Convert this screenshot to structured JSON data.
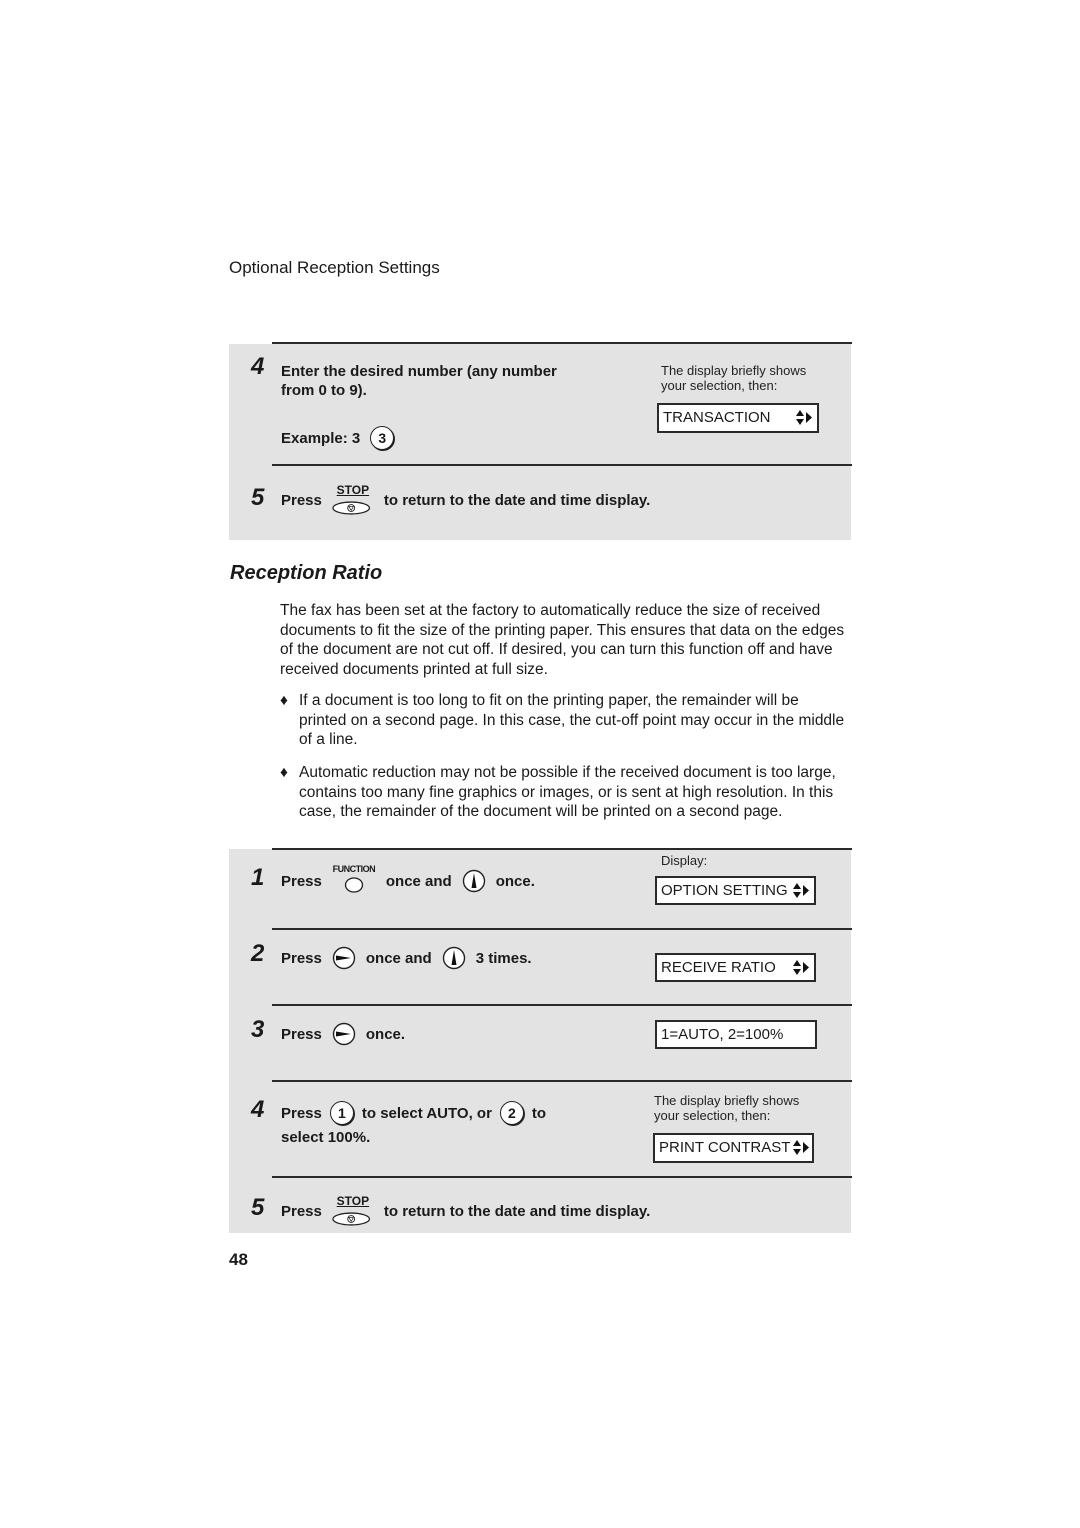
{
  "page": {
    "section_header": "Optional Reception Settings",
    "page_number": "48"
  },
  "top_procedure": {
    "steps": [
      {
        "number": "4",
        "text_line1": "Enter the desired number (any number",
        "text_line2": "from 0 to 9).",
        "example_label": "Example: 3",
        "example_key": "3",
        "note_line1": "The display briefly shows",
        "note_line2": "your selection, then:",
        "display": "TRANSACTION"
      },
      {
        "number": "5",
        "press": "Press",
        "key_label": "STOP",
        "text": "to return to the date and time display."
      }
    ]
  },
  "reception_ratio": {
    "heading": "Reception Ratio",
    "paragraph": "The fax has been set at the factory to automatically reduce the size of received documents to fit the size of the printing paper. This ensures that data on the edges of the document are not cut off. If desired, you can turn this function off and have received documents printed at full size.",
    "bullets": [
      "If a document is too long to fit on the printing paper, the remainder will be printed on a second page. In this case, the cut-off point may occur in the middle of a line.",
      "Automatic reduction may not be possible if the received document is too large, contains too many fine graphics or images, or is sent at high resolution. In this case, the remainder of the document will be printed on a second page."
    ],
    "bullet_glyph": "♦"
  },
  "bottom_procedure": {
    "display_label": "Display:",
    "steps": [
      {
        "number": "1",
        "press": "Press",
        "key1_label": "FUNCTION",
        "mid": "once and",
        "end": "once.",
        "display": "OPTION SETTING"
      },
      {
        "number": "2",
        "press": "Press",
        "mid": "once and",
        "end": "3 times.",
        "display": "RECEIVE RATIO"
      },
      {
        "number": "3",
        "press": "Press",
        "end": "once.",
        "display": "1=AUTO, 2=100%"
      },
      {
        "number": "4",
        "press": "Press",
        "key1": "1",
        "mid": "to select AUTO, or",
        "key2": "2",
        "end": "to",
        "line2": "select 100%.",
        "note_line1": "The display briefly shows",
        "note_line2": "your selection, then:",
        "display": "PRINT CONTRAST"
      },
      {
        "number": "5",
        "press": "Press",
        "key_label": "STOP",
        "text": "to return to the date and time display."
      }
    ]
  }
}
